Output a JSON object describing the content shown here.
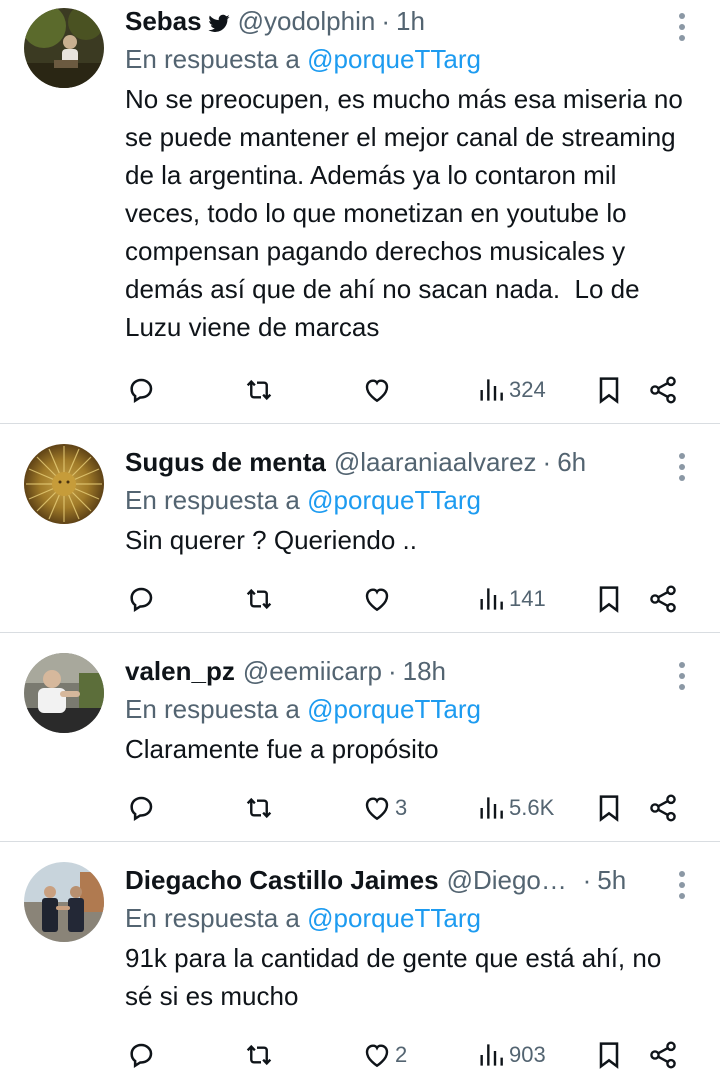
{
  "colors": {
    "name": "#0f1419",
    "muted": "#536471",
    "link": "#1d9bf0",
    "divider": "#d9dde1"
  },
  "reply_prefix": "En respuesta a",
  "tweets": [
    {
      "name": "Sebas",
      "verified_icon": "bird-icon",
      "handle": "@yodolphin",
      "time": "1h",
      "reply_to": "@porqueTTarg",
      "text": "No se preocupen, es mucho más esa miseria no se puede mantener el mejor canal de streaming de la argentina. Además ya lo contaron mil veces, todo lo que monetizan en youtube lo compensan pagando derechos musicales y demás así que de ahí no sacan nada.  Lo de Luzu viene de marcas",
      "likes": "",
      "views": "324"
    },
    {
      "name": "Sugus de menta",
      "handle": "@laaraniaalvarez",
      "time": "6h",
      "reply_to": "@porqueTTarg",
      "text": "Sin querer ? Queriendo ..",
      "likes": "",
      "views": "141"
    },
    {
      "name": "valen_pz",
      "handle": "@eemiicarp",
      "time": "18h",
      "reply_to": "@porqueTTarg",
      "text": "Claramente fue a propósito",
      "likes": "3",
      "views": "5.6K"
    },
    {
      "name": "Diegacho Castillo Jaimes",
      "handle": "@Diego_...",
      "time": "5h",
      "reply_to": "@porqueTTarg",
      "text": "91k para la cantidad de gente que está ahí, no sé si es mucho",
      "likes": "2",
      "views": "903"
    }
  ]
}
